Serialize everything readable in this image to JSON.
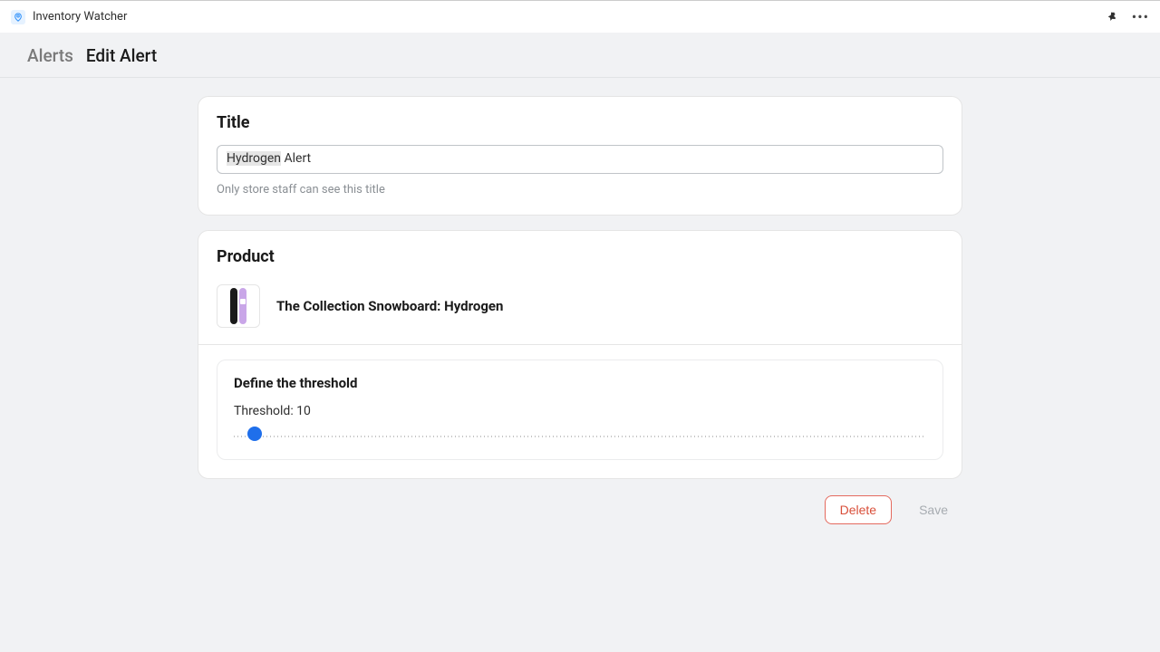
{
  "header": {
    "app_title": "Inventory Watcher"
  },
  "breadcrumb": {
    "parent": "Alerts",
    "current": "Edit Alert"
  },
  "title_card": {
    "heading": "Title",
    "input_value": "Hydrogen Alert",
    "highlight_prefix": "Hydrogen",
    "highlight_rest": " Alert",
    "help": "Only store staff can see this title"
  },
  "product_card": {
    "heading": "Product",
    "name": "The Collection Snowboard: Hydrogen"
  },
  "threshold": {
    "heading": "Define the threshold",
    "label": "Threshold: 10",
    "value": 10,
    "min": 0,
    "max": 500
  },
  "actions": {
    "delete": "Delete",
    "save": "Save"
  }
}
